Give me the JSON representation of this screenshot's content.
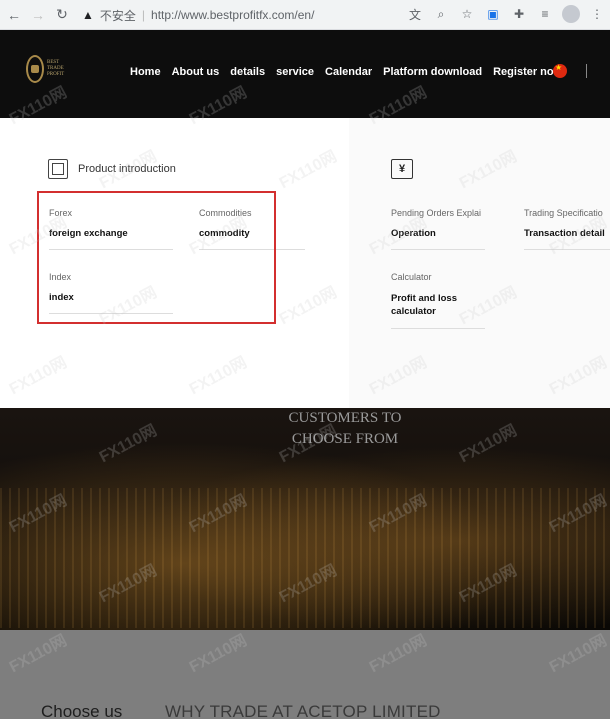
{
  "browser": {
    "security_label": "不安全",
    "url": "http://www.bestprofitfx.com/en/"
  },
  "logo": {
    "text": "BEST TRADE PROFIT"
  },
  "nav": {
    "items": [
      "Home",
      "About us",
      "details",
      "service",
      "Calendar",
      "Platform download",
      "Register now"
    ],
    "active_item": "details",
    "accent_color": "#c8102e"
  },
  "dropdown": {
    "left_header": "Product introduction",
    "left_items": [
      {
        "caption": "Forex",
        "value": "foreign exchange"
      },
      {
        "caption": "Commodities",
        "value": "commodity"
      },
      {
        "caption": "Index",
        "value": "index"
      }
    ],
    "right_items": [
      {
        "caption": "Pending Orders Explai",
        "value": "Operation"
      },
      {
        "caption": "Trading Specificatio",
        "value": "Transaction detail"
      },
      {
        "caption": "Calculator",
        "value": "Profit and loss calculator"
      }
    ],
    "highlight_color": "#d32f2f"
  },
  "hero": {
    "line1": "CUSTOMERS TO",
    "line2": "CHOOSE FROM"
  },
  "lower": {
    "choose": "Choose us",
    "why": "WHY TRADE AT ACETOP LIMITED"
  },
  "watermark_text": "FX110网"
}
